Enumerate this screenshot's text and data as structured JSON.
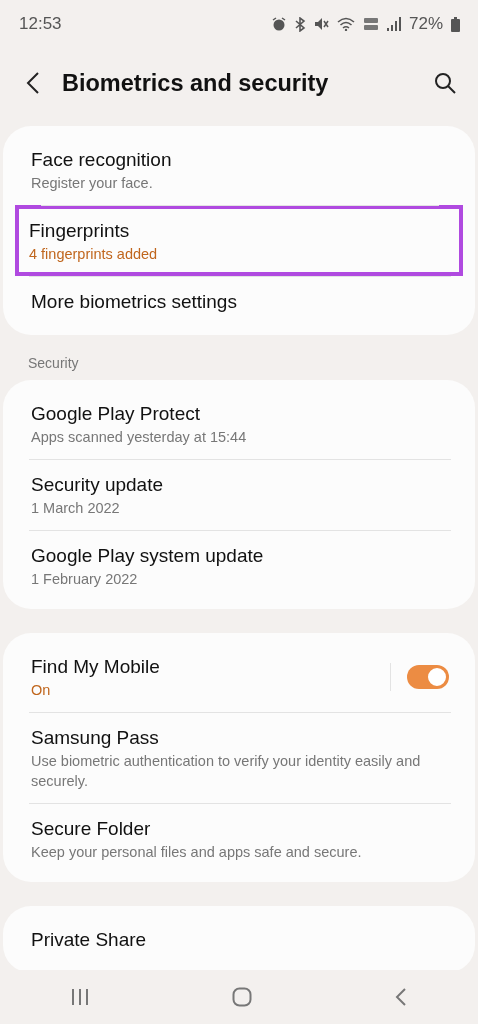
{
  "status_bar": {
    "time": "12:53",
    "battery": "72%"
  },
  "header": {
    "title": "Biometrics and security"
  },
  "groups": [
    {
      "items": [
        {
          "title": "Face recognition",
          "subtitle": "Register your face.",
          "accent": false,
          "highlighted": false
        },
        {
          "title": "Fingerprints",
          "subtitle": "4 fingerprints added",
          "accent": true,
          "highlighted": true
        },
        {
          "title": "More biometrics settings",
          "highlighted": false
        }
      ]
    },
    {
      "heading": "Security",
      "items": [
        {
          "title": "Google Play Protect",
          "subtitle": "Apps scanned yesterday at 15:44",
          "accent": false,
          "highlighted": false
        },
        {
          "title": "Security update",
          "subtitle": "1 March 2022",
          "accent": false,
          "highlighted": false
        },
        {
          "title": "Google Play system update",
          "subtitle": "1 February 2022",
          "accent": false,
          "highlighted": false
        }
      ]
    },
    {
      "items": [
        {
          "title": "Find My Mobile",
          "subtitle": "On",
          "accent": true,
          "highlighted": false,
          "toggle": {
            "on": true
          }
        },
        {
          "title": "Samsung Pass",
          "subtitle": "Use biometric authentication to verify your identity easily and securely.",
          "accent": false,
          "highlighted": false
        },
        {
          "title": "Secure Folder",
          "subtitle": "Keep your personal files and apps safe and secure.",
          "accent": false,
          "highlighted": false
        }
      ]
    },
    {
      "items": [
        {
          "title": "Private Share",
          "highlighted": false
        }
      ]
    }
  ]
}
